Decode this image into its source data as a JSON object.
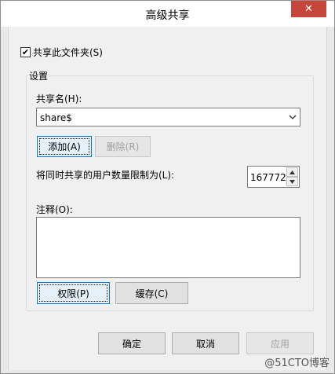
{
  "window": {
    "title": "高级共享",
    "close_glyph": "✕"
  },
  "share_checkbox": {
    "label": "共享此文件夹(S)",
    "checked": true,
    "check_glyph": "✔"
  },
  "settings": {
    "group_label": "设置",
    "share_name_label": "共享名(H):",
    "share_name_value": "share$",
    "add_button": "添加(A)",
    "delete_button": "删除(R)",
    "user_limit_label": "将同时共享的用户数量限制为(L):",
    "user_limit_value": "167772",
    "comment_label": "注释(O):",
    "comment_value": "",
    "permissions_button": "权限(P)",
    "cache_button": "缓存(C)"
  },
  "footer": {
    "ok_button": "确定",
    "cancel_button": "取消",
    "apply_button": "应用"
  },
  "watermark": "@51CTO博客",
  "colors": {
    "close": "#c7463b",
    "focus": "#0078d7"
  }
}
